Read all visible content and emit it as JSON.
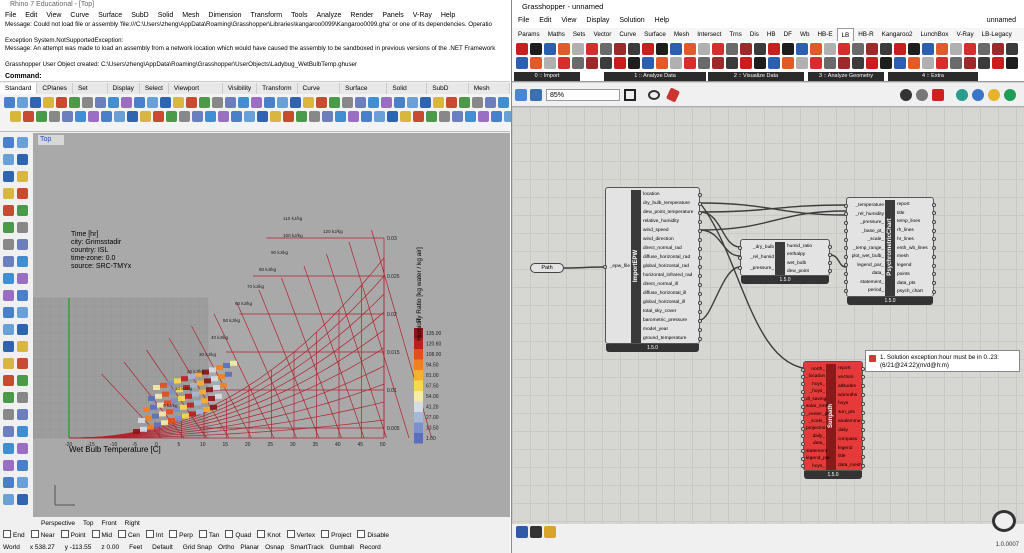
{
  "rhino": {
    "title": "Rhino 7 Educational - [Top]",
    "menu": [
      "File",
      "Edit",
      "View",
      "Curve",
      "Surface",
      "SubD",
      "Solid",
      "Mesh",
      "Dimension",
      "Transform",
      "Tools",
      "Analyze",
      "Render",
      "Panels",
      "V-Ray",
      "Help"
    ],
    "history": [
      "Message: Could not load file or assembly 'file:///C:\\Users\\zheng\\AppData\\Roaming\\Grasshopper\\Libraries\\kangaroo0099\\Kangaroo0099.gha' or one of its dependencies. Operatio",
      "",
      "Exception System.NotSupportedException:",
      "Message: An attempt was made to load an assembly from a network location which would have caused the assembly to be sandboxed in previous versions of the .NET Framework",
      "",
      "Grasshopper User Object created: C:\\Users\\zheng\\AppData\\Roaming\\Grasshopper\\UserObjects\\Ladybug_WetBulbTemp.ghuser"
    ],
    "command_label": "Command:",
    "toolbar_tabs": [
      "Standard",
      "CPlanes",
      "Set View",
      "Display",
      "Select",
      "Viewport Layout",
      "Visibility",
      "Transform",
      "Curve Tools",
      "Surface Tools",
      "Solid Tools",
      "SubD Tools",
      "Mesh Tools"
    ],
    "viewport": {
      "name": "Top",
      "info": [
        "Time [hr]",
        "city: Grimsstadir",
        "country: ISL",
        "time-zone: 0.0",
        "source: SRC-TMYx"
      ],
      "chart_xlabel": "Wet Bulb Temperature [C]",
      "chart_ylabel": "Humidity Ratio [kg water / kg air]",
      "x_ticks": [
        "-20",
        "-15",
        "-10",
        "-5",
        "0",
        "5",
        "10",
        "15",
        "20",
        "25",
        "30",
        "35",
        "40",
        "45",
        "50"
      ],
      "y_ticks": [
        "0.03",
        "0.025",
        "0.02",
        "0.015",
        "0.01",
        "0.005"
      ],
      "enthalpy_labels": [
        "110 kJ/kg",
        "120 kJ/kg",
        "100 kJ/kg",
        "90 kJ/kg",
        "80 kJ/kg",
        "70 kJ/kg",
        "60 kJ/kg",
        "50 kJ/kg",
        "40 kJ/kg",
        "30 kJ/kg",
        "20 kJ/kg",
        "10 kJ/kg",
        "0 kJ/kg"
      ],
      "legend_title": "hr",
      "legend_values": [
        "135.00",
        "120.60",
        "108.00",
        "94.50",
        "81.00",
        "67.50",
        "54.00",
        "41.20",
        "27.00",
        "13.50",
        "1.00"
      ],
      "legend_colors": [
        "#8a1414",
        "#c01e1e",
        "#e64b1c",
        "#f2801f",
        "#f7b02a",
        "#f9d94a",
        "#f5eda6",
        "#d6dce6",
        "#a7b7d6",
        "#7c90c9",
        "#5a6fbd"
      ]
    },
    "viewport_tabs": [
      "Perspective",
      "Top",
      "Front",
      "Right"
    ],
    "osnaps": [
      "End",
      "Near",
      "Point",
      "Mid",
      "Cen",
      "Int",
      "Perp",
      "Tan",
      "Quad",
      "Knot",
      "Vertex",
      "Project",
      "Disable"
    ],
    "status": {
      "cplane": "World",
      "x": "x 538.27",
      "y": "y -113.55",
      "z": "z 0.00",
      "units": "Feet",
      "layer": "Default",
      "items": [
        "Grid Snap",
        "Ortho",
        "Planar",
        "Osnap",
        "SmartTrack",
        "Gumball",
        "Record"
      ]
    }
  },
  "gh": {
    "title": "Grasshopper - unnamed",
    "docname": "unnamed",
    "menu": [
      "File",
      "Edit",
      "View",
      "Display",
      "Solution",
      "Help"
    ],
    "tabs": [
      "Params",
      "Maths",
      "Sets",
      "Vector",
      "Curve",
      "Surface",
      "Mesh",
      "Intersect",
      "Trns",
      "Dis",
      "HB",
      "DF",
      "Wb",
      "HB-E",
      "LB",
      "HB-R",
      "Kangaroo2",
      "LunchBox",
      "V-Ray",
      "LB-Legacy"
    ],
    "active_tab": "LB",
    "ribbon_groups": [
      "0 :: Import",
      "1 :: Analyze Data",
      "2 :: Visualize Data",
      "3 :: Analyze Geometry",
      "4 :: Extra"
    ],
    "zoom": "85%",
    "version": "1.0.0007",
    "path_param": "Path",
    "import_epw": {
      "name": "ImportEPW",
      "input": "_epw_file",
      "outputs": [
        "location",
        "dry_bulb_temperature",
        "dew_point_temperature",
        "relative_humidity",
        "wind_speed",
        "wind_direction",
        "direct_normal_rad",
        "diffuse_horizontal_rad",
        "global_horizontal_rad",
        "horizontal_infrared_rad",
        "direct_normal_ill",
        "diffuse_horizontal_ill",
        "global_horizontal_ill",
        "total_sky_cover",
        "barometric_pressure",
        "model_year",
        "ground_temperature"
      ],
      "ver": "1.5.0"
    },
    "wetbulb": {
      "inputs": [
        "_dry_bulb",
        "_rel_humid",
        "_pressure_"
      ],
      "outputs": [
        "humid_ratio",
        "enthalpy",
        "wet_bulb",
        "dew_point"
      ],
      "ver": "1.5.0"
    },
    "psychro": {
      "name": "PsychrometricChart",
      "inputs": [
        "_temperature",
        "_rel_humidity",
        "_pressure_",
        "_base_pt_",
        "_scale_",
        "_temp_range_",
        "plot_wet_bulb_",
        "legend_par_",
        "data_",
        "statement_",
        "period_"
      ],
      "outputs": [
        "report",
        "title",
        "temp_lines",
        "rh_lines",
        "hr_lines",
        "enth_wb_lines",
        "mesh",
        "legend",
        "points",
        "data_pts",
        "psych_chart"
      ],
      "ver": "1.5.0"
    },
    "sunpath": {
      "name": "Sunpath",
      "inputs": [
        "north_",
        "_location",
        "hoys_",
        "_hoys_",
        "dl_saving",
        "solar_time",
        "_center_pt",
        "_scale_",
        "projection",
        "daily_",
        "data_",
        "statement",
        "legend_par",
        "hoys_"
      ],
      "outputs": [
        "report",
        "vectors",
        "altitudes",
        "azimuths",
        "hoys",
        "sun_pts",
        "analemma",
        "daily",
        "compass",
        "legend",
        "title",
        "data_mesh"
      ],
      "ver": "1.5.0"
    },
    "error": "1. Solution exception:hour must be in 0..23: (6/21@24:22)(m/d@h:m)"
  }
}
